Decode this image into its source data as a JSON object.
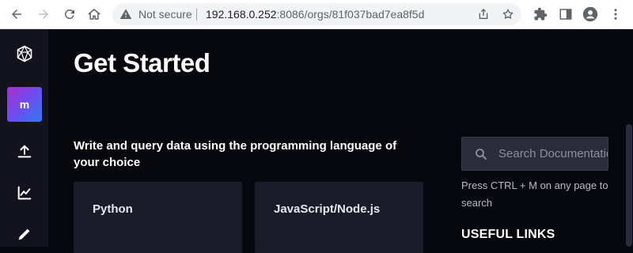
{
  "browser": {
    "security_label": "Not secure",
    "url_host": "192.168.0.252",
    "url_path": ":8086/orgs/81f037bad7ea8f5d"
  },
  "sidebar": {
    "org_initial": "m",
    "items": [
      {
        "icon": "logo-icon"
      },
      {
        "icon": "org-avatar"
      },
      {
        "icon": "upload-icon"
      },
      {
        "icon": "chart-icon"
      },
      {
        "icon": "pencil-icon"
      }
    ]
  },
  "main": {
    "title": "Get Started",
    "subtitle": "Write and query data using the programming language of your choice",
    "cards": [
      {
        "label": "Python"
      },
      {
        "label": "JavaScript/Node.js"
      }
    ],
    "search": {
      "placeholder": "Search Documentation",
      "hint": "Press CTRL + M on any page to search"
    },
    "useful_links_heading": "USEFUL LINKS"
  },
  "colors": {
    "background": "#07070e",
    "sidebar": "#12131e",
    "card": "#1b1b2a",
    "avatar_gradient_start": "#a72fcc",
    "avatar_gradient_end": "#2f7cf6"
  }
}
